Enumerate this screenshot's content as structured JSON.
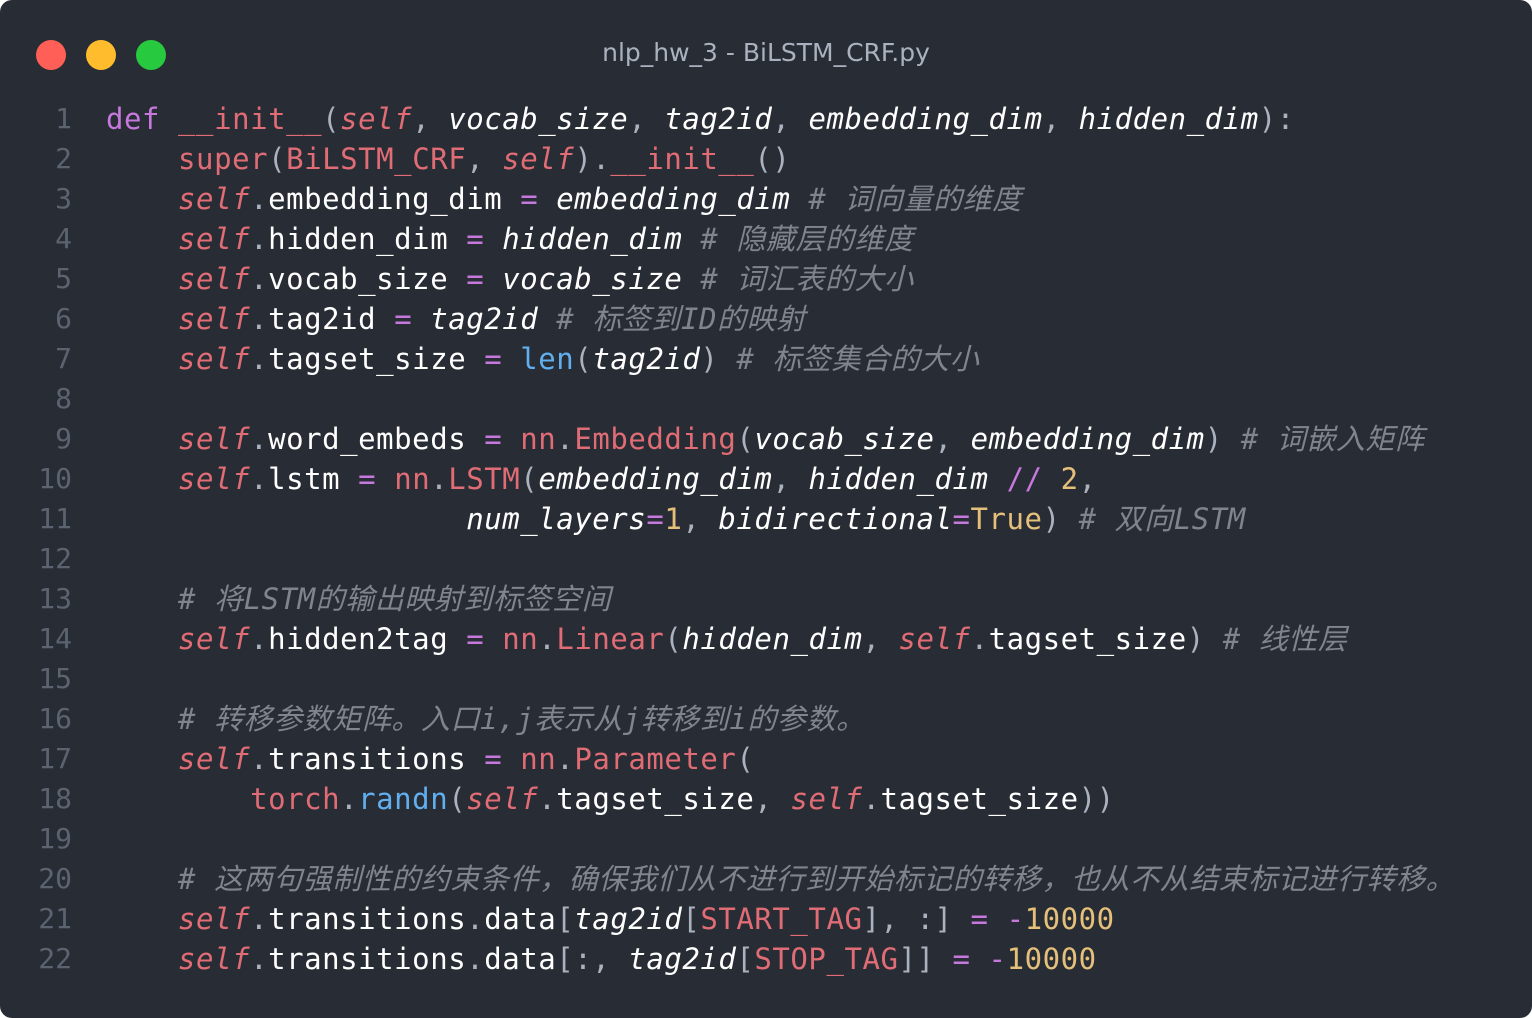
{
  "window": {
    "title": "nlp_hw_3 - BiLSTM_CRF.py",
    "controls": {
      "close_color": "#ff5f56",
      "minimize_color": "#ffbd2e",
      "zoom_color": "#27c93f"
    }
  },
  "theme": {
    "background": "#282c34",
    "keyword": "#c678dd",
    "function": "#e06c75",
    "comment": "#7f848e",
    "number": "#e5c07b",
    "builtin": "#61afef",
    "plain": "#abb2bf"
  },
  "code": {
    "lines": [
      {
        "n": "1",
        "tokens": [
          [
            "kw",
            "def"
          ],
          [
            "p",
            " "
          ],
          [
            "fn",
            "__init__"
          ],
          [
            "p",
            "("
          ],
          [
            "self",
            "self"
          ],
          [
            "p",
            ", "
          ],
          [
            "arg",
            "vocab_size"
          ],
          [
            "p",
            ", "
          ],
          [
            "arg",
            "tag2id"
          ],
          [
            "p",
            ", "
          ],
          [
            "arg",
            "embedding_dim"
          ],
          [
            "p",
            ", "
          ],
          [
            "arg",
            "hidden_dim"
          ],
          [
            "p",
            "):"
          ]
        ]
      },
      {
        "n": "2",
        "tokens": [
          [
            "p",
            "    "
          ],
          [
            "fn",
            "super"
          ],
          [
            "p",
            "("
          ],
          [
            "cls",
            "BiLSTM_CRF"
          ],
          [
            "p",
            ", "
          ],
          [
            "self",
            "self"
          ],
          [
            "p",
            ")."
          ],
          [
            "fn",
            "__init__"
          ],
          [
            "p",
            "()"
          ]
        ]
      },
      {
        "n": "3",
        "tokens": [
          [
            "p",
            "    "
          ],
          [
            "self",
            "self"
          ],
          [
            "p",
            "."
          ],
          [
            "attr",
            "embedding_dim"
          ],
          [
            "p",
            " "
          ],
          [
            "op",
            "="
          ],
          [
            "p",
            " "
          ],
          [
            "arg",
            "embedding_dim"
          ],
          [
            "p",
            " "
          ],
          [
            "cm",
            "# 词向量的维度"
          ]
        ]
      },
      {
        "n": "4",
        "tokens": [
          [
            "p",
            "    "
          ],
          [
            "self",
            "self"
          ],
          [
            "p",
            "."
          ],
          [
            "attr",
            "hidden_dim"
          ],
          [
            "p",
            " "
          ],
          [
            "op",
            "="
          ],
          [
            "p",
            " "
          ],
          [
            "arg",
            "hidden_dim"
          ],
          [
            "p",
            " "
          ],
          [
            "cm",
            "# 隐藏层的维度"
          ]
        ]
      },
      {
        "n": "5",
        "tokens": [
          [
            "p",
            "    "
          ],
          [
            "self",
            "self"
          ],
          [
            "p",
            "."
          ],
          [
            "attr",
            "vocab_size"
          ],
          [
            "p",
            " "
          ],
          [
            "op",
            "="
          ],
          [
            "p",
            " "
          ],
          [
            "arg",
            "vocab_size"
          ],
          [
            "p",
            " "
          ],
          [
            "cm",
            "# 词汇表的大小"
          ]
        ]
      },
      {
        "n": "6",
        "tokens": [
          [
            "p",
            "    "
          ],
          [
            "self",
            "self"
          ],
          [
            "p",
            "."
          ],
          [
            "attr",
            "tag2id"
          ],
          [
            "p",
            " "
          ],
          [
            "op",
            "="
          ],
          [
            "p",
            " "
          ],
          [
            "arg",
            "tag2id"
          ],
          [
            "p",
            " "
          ],
          [
            "cm",
            "# 标签到ID的映射"
          ]
        ]
      },
      {
        "n": "7",
        "tokens": [
          [
            "p",
            "    "
          ],
          [
            "self",
            "self"
          ],
          [
            "p",
            "."
          ],
          [
            "attr",
            "tagset_size"
          ],
          [
            "p",
            " "
          ],
          [
            "op",
            "="
          ],
          [
            "p",
            " "
          ],
          [
            "bi",
            "len"
          ],
          [
            "p",
            "("
          ],
          [
            "arg",
            "tag2id"
          ],
          [
            "p",
            ") "
          ],
          [
            "cm",
            "# 标签集合的大小"
          ]
        ]
      },
      {
        "n": "8",
        "tokens": []
      },
      {
        "n": "9",
        "tokens": [
          [
            "p",
            "    "
          ],
          [
            "self",
            "self"
          ],
          [
            "p",
            "."
          ],
          [
            "attr",
            "word_embeds"
          ],
          [
            "p",
            " "
          ],
          [
            "op",
            "="
          ],
          [
            "p",
            " "
          ],
          [
            "mod",
            "nn"
          ],
          [
            "p",
            "."
          ],
          [
            "cls",
            "Embedding"
          ],
          [
            "p",
            "("
          ],
          [
            "arg",
            "vocab_size"
          ],
          [
            "p",
            ", "
          ],
          [
            "arg",
            "embedding_dim"
          ],
          [
            "p",
            ") "
          ],
          [
            "cm",
            "# 词嵌入矩阵"
          ]
        ]
      },
      {
        "n": "10",
        "tokens": [
          [
            "p",
            "    "
          ],
          [
            "self",
            "self"
          ],
          [
            "p",
            "."
          ],
          [
            "attr",
            "lstm"
          ],
          [
            "p",
            " "
          ],
          [
            "op",
            "="
          ],
          [
            "p",
            " "
          ],
          [
            "mod",
            "nn"
          ],
          [
            "p",
            "."
          ],
          [
            "cls",
            "LSTM"
          ],
          [
            "p",
            "("
          ],
          [
            "arg",
            "embedding_dim"
          ],
          [
            "p",
            ", "
          ],
          [
            "arg",
            "hidden_dim"
          ],
          [
            "p",
            " "
          ],
          [
            "op",
            "//"
          ],
          [
            "p",
            " "
          ],
          [
            "num",
            "2"
          ],
          [
            "p",
            ","
          ]
        ]
      },
      {
        "n": "11",
        "tokens": [
          [
            "p",
            "                    "
          ],
          [
            "arg",
            "num_layers"
          ],
          [
            "op",
            "="
          ],
          [
            "num",
            "1"
          ],
          [
            "p",
            ", "
          ],
          [
            "arg",
            "bidirectional"
          ],
          [
            "op",
            "="
          ],
          [
            "num",
            "True"
          ],
          [
            "p",
            ") "
          ],
          [
            "cm",
            "# 双向LSTM"
          ]
        ]
      },
      {
        "n": "12",
        "tokens": []
      },
      {
        "n": "13",
        "tokens": [
          [
            "p",
            "    "
          ],
          [
            "cm",
            "# 将LSTM的输出映射到标签空间"
          ]
        ]
      },
      {
        "n": "14",
        "tokens": [
          [
            "p",
            "    "
          ],
          [
            "self",
            "self"
          ],
          [
            "p",
            "."
          ],
          [
            "attr",
            "hidden2tag"
          ],
          [
            "p",
            " "
          ],
          [
            "op",
            "="
          ],
          [
            "p",
            " "
          ],
          [
            "mod",
            "nn"
          ],
          [
            "p",
            "."
          ],
          [
            "cls",
            "Linear"
          ],
          [
            "p",
            "("
          ],
          [
            "arg",
            "hidden_dim"
          ],
          [
            "p",
            ", "
          ],
          [
            "self",
            "self"
          ],
          [
            "p",
            "."
          ],
          [
            "attr",
            "tagset_size"
          ],
          [
            "p",
            ") "
          ],
          [
            "cm",
            "# 线性层"
          ]
        ]
      },
      {
        "n": "15",
        "tokens": []
      },
      {
        "n": "16",
        "tokens": [
          [
            "p",
            "    "
          ],
          [
            "cm",
            "# 转移参数矩阵。入口i,j表示从j转移到i的参数。"
          ]
        ]
      },
      {
        "n": "17",
        "tokens": [
          [
            "p",
            "    "
          ],
          [
            "self",
            "self"
          ],
          [
            "p",
            "."
          ],
          [
            "attr",
            "transitions"
          ],
          [
            "p",
            " "
          ],
          [
            "op",
            "="
          ],
          [
            "p",
            " "
          ],
          [
            "mod",
            "nn"
          ],
          [
            "p",
            "."
          ],
          [
            "cls",
            "Parameter"
          ],
          [
            "p",
            "("
          ]
        ]
      },
      {
        "n": "18",
        "tokens": [
          [
            "p",
            "        "
          ],
          [
            "mod",
            "torch"
          ],
          [
            "p",
            "."
          ],
          [
            "bi",
            "randn"
          ],
          [
            "p",
            "("
          ],
          [
            "self",
            "self"
          ],
          [
            "p",
            "."
          ],
          [
            "attr",
            "tagset_size"
          ],
          [
            "p",
            ", "
          ],
          [
            "self",
            "self"
          ],
          [
            "p",
            "."
          ],
          [
            "attr",
            "tagset_size"
          ],
          [
            "p",
            "))"
          ]
        ]
      },
      {
        "n": "19",
        "tokens": []
      },
      {
        "n": "20",
        "tokens": [
          [
            "p",
            "    "
          ],
          [
            "cm",
            "# 这两句强制性的约束条件，确保我们从不进行到开始标记的转移，也从不从结束标记进行转移。"
          ]
        ]
      },
      {
        "n": "21",
        "tokens": [
          [
            "p",
            "    "
          ],
          [
            "self",
            "self"
          ],
          [
            "p",
            "."
          ],
          [
            "attr",
            "transitions"
          ],
          [
            "p",
            "."
          ],
          [
            "attr",
            "data"
          ],
          [
            "p",
            "["
          ],
          [
            "arg",
            "tag2id"
          ],
          [
            "p",
            "["
          ],
          [
            "cls",
            "START_TAG"
          ],
          [
            "p",
            "], :] "
          ],
          [
            "op",
            "="
          ],
          [
            "p",
            " "
          ],
          [
            "op",
            "-"
          ],
          [
            "num",
            "10000"
          ]
        ]
      },
      {
        "n": "22",
        "tokens": [
          [
            "p",
            "    "
          ],
          [
            "self",
            "self"
          ],
          [
            "p",
            "."
          ],
          [
            "attr",
            "transitions"
          ],
          [
            "p",
            "."
          ],
          [
            "attr",
            "data"
          ],
          [
            "p",
            "[:, "
          ],
          [
            "arg",
            "tag2id"
          ],
          [
            "p",
            "["
          ],
          [
            "cls",
            "STOP_TAG"
          ],
          [
            "p",
            "]] "
          ],
          [
            "op",
            "="
          ],
          [
            "p",
            " "
          ],
          [
            "op",
            "-"
          ],
          [
            "num",
            "10000"
          ]
        ]
      }
    ]
  }
}
